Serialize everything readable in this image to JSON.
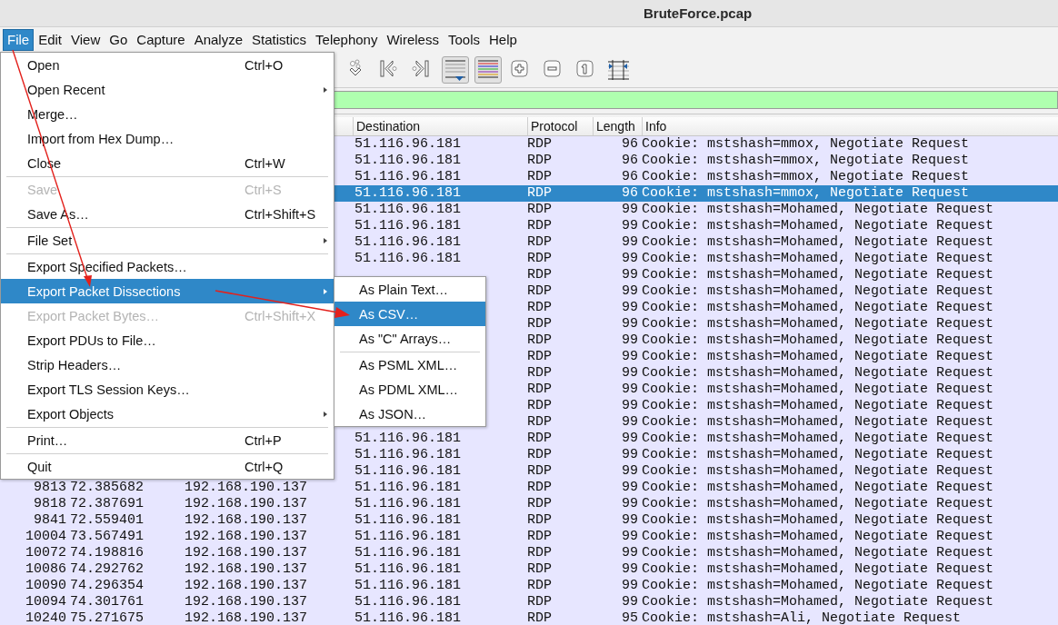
{
  "window": {
    "title": "BruteForce.pcap"
  },
  "menubar": [
    {
      "label": "File",
      "selected": true
    },
    {
      "label": "Edit",
      "selected": false
    },
    {
      "label": "View",
      "selected": false
    },
    {
      "label": "Go",
      "selected": false
    },
    {
      "label": "Capture",
      "selected": false
    },
    {
      "label": "Analyze",
      "selected": false
    },
    {
      "label": "Statistics",
      "selected": false
    },
    {
      "label": "Telephony",
      "selected": false
    },
    {
      "label": "Wireless",
      "selected": false
    },
    {
      "label": "Tools",
      "selected": false
    },
    {
      "label": "Help",
      "selected": false
    }
  ],
  "toolbar": [
    {
      "kind": "next-packet",
      "on": false
    },
    {
      "kind": "first-packet",
      "on": false
    },
    {
      "kind": "last-packet",
      "on": false
    },
    {
      "kind": "autoscroll",
      "on": true
    },
    {
      "kind": "colorize",
      "on": true
    },
    {
      "kind": "zoom-in",
      "on": false
    },
    {
      "kind": "zoom-out",
      "on": false
    },
    {
      "kind": "normal-size",
      "on": false
    },
    {
      "kind": "resize-columns",
      "on": false
    }
  ],
  "filter_bar": {
    "valid": true
  },
  "table": {
    "columns": [
      "Destination",
      "Protocol",
      "Length",
      "Info"
    ],
    "rows": [
      {
        "destination": "51.116.96.181",
        "protocol": "RDP",
        "length": "96",
        "info": "Cookie: mstshash=mmox, Negotiate Request",
        "selected": false
      },
      {
        "destination": "51.116.96.181",
        "protocol": "RDP",
        "length": "96",
        "info": "Cookie: mstshash=mmox, Negotiate Request",
        "selected": false
      },
      {
        "destination": "51.116.96.181",
        "protocol": "RDP",
        "length": "96",
        "info": "Cookie: mstshash=mmox, Negotiate Request",
        "selected": false
      },
      {
        "destination": "51.116.96.181",
        "protocol": "RDP",
        "length": "96",
        "info": "Cookie: mstshash=mmox, Negotiate Request",
        "selected": true
      },
      {
        "destination": "51.116.96.181",
        "protocol": "RDP",
        "length": "99",
        "info": "Cookie: mstshash=Mohamed, Negotiate Request",
        "selected": false
      },
      {
        "destination": "51.116.96.181",
        "protocol": "RDP",
        "length": "99",
        "info": "Cookie: mstshash=Mohamed, Negotiate Request",
        "selected": false
      },
      {
        "destination": "51.116.96.181",
        "protocol": "RDP",
        "length": "99",
        "info": "Cookie: mstshash=Mohamed, Negotiate Request",
        "selected": false
      },
      {
        "destination": "51.116.96.181",
        "protocol": "RDP",
        "length": "99",
        "info": "Cookie: mstshash=Mohamed, Negotiate Request",
        "selected": false
      },
      {
        "protocol": "RDP",
        "length": "99",
        "info": "Cookie: mstshash=Mohamed, Negotiate Request",
        "selected": false
      },
      {
        "protocol": "RDP",
        "length": "99",
        "info": "Cookie: mstshash=Mohamed, Negotiate Request",
        "selected": false
      },
      {
        "protocol": "RDP",
        "length": "99",
        "info": "Cookie: mstshash=Mohamed, Negotiate Request",
        "selected": false
      },
      {
        "protocol": "RDP",
        "length": "99",
        "info": "Cookie: mstshash=Mohamed, Negotiate Request",
        "selected": false
      },
      {
        "protocol": "RDP",
        "length": "99",
        "info": "Cookie: mstshash=Mohamed, Negotiate Request",
        "selected": false
      },
      {
        "protocol": "RDP",
        "length": "99",
        "info": "Cookie: mstshash=Mohamed, Negotiate Request",
        "selected": false
      },
      {
        "protocol": "RDP",
        "length": "99",
        "info": "Cookie: mstshash=Mohamed, Negotiate Request",
        "selected": false
      },
      {
        "protocol": "RDP",
        "length": "99",
        "info": "Cookie: mstshash=Mohamed, Negotiate Request",
        "selected": false
      },
      {
        "protocol": "RDP",
        "length": "99",
        "info": "Cookie: mstshash=Mohamed, Negotiate Request",
        "selected": false
      },
      {
        "protocol": "RDP",
        "length": "99",
        "info": "Cookie: mstshash=Mohamed, Negotiate Request",
        "selected": false
      },
      {
        "destination": "51.116.96.181",
        "protocol": "RDP",
        "length": "99",
        "info": "Cookie: mstshash=Mohamed, Negotiate Request",
        "selected": false
      },
      {
        "destination": "51.116.96.181",
        "protocol": "RDP",
        "length": "99",
        "info": "Cookie: mstshash=Mohamed, Negotiate Request",
        "selected": false
      },
      {
        "destination": "51.116.96.181",
        "protocol": "RDP",
        "length": "99",
        "info": "Cookie: mstshash=Mohamed, Negotiate Request",
        "selected": false
      },
      {
        "no": "9813",
        "time": "72.385682",
        "source": "192.168.190.137",
        "destination": "51.116.96.181",
        "protocol": "RDP",
        "length": "99",
        "info": "Cookie: mstshash=Mohamed, Negotiate Request",
        "selected": false
      },
      {
        "no": "9818",
        "time": "72.387691",
        "source": "192.168.190.137",
        "destination": "51.116.96.181",
        "protocol": "RDP",
        "length": "99",
        "info": "Cookie: mstshash=Mohamed, Negotiate Request",
        "selected": false
      },
      {
        "no": "9841",
        "time": "72.559401",
        "source": "192.168.190.137",
        "destination": "51.116.96.181",
        "protocol": "RDP",
        "length": "99",
        "info": "Cookie: mstshash=Mohamed, Negotiate Request",
        "selected": false
      },
      {
        "no": "10004",
        "time": "73.567491",
        "source": "192.168.190.137",
        "destination": "51.116.96.181",
        "protocol": "RDP",
        "length": "99",
        "info": "Cookie: mstshash=Mohamed, Negotiate Request",
        "selected": false
      },
      {
        "no": "10072",
        "time": "74.198816",
        "source": "192.168.190.137",
        "destination": "51.116.96.181",
        "protocol": "RDP",
        "length": "99",
        "info": "Cookie: mstshash=Mohamed, Negotiate Request",
        "selected": false
      },
      {
        "no": "10086",
        "time": "74.292762",
        "source": "192.168.190.137",
        "destination": "51.116.96.181",
        "protocol": "RDP",
        "length": "99",
        "info": "Cookie: mstshash=Mohamed, Negotiate Request",
        "selected": false
      },
      {
        "no": "10090",
        "time": "74.296354",
        "source": "192.168.190.137",
        "destination": "51.116.96.181",
        "protocol": "RDP",
        "length": "99",
        "info": "Cookie: mstshash=Mohamed, Negotiate Request",
        "selected": false
      },
      {
        "no": "10094",
        "time": "74.301761",
        "source": "192.168.190.137",
        "destination": "51.116.96.181",
        "protocol": "RDP",
        "length": "99",
        "info": "Cookie: mstshash=Mohamed, Negotiate Request",
        "selected": false
      },
      {
        "no": "10240",
        "time": "75.271675",
        "source": "192.168.190.137",
        "destination": "51.116.96.181",
        "protocol": "RDP",
        "length": "95",
        "info": "Cookie: mstshash=Ali, Negotiate Request",
        "selected": false
      }
    ]
  },
  "file_menu": {
    "items": [
      {
        "kind": "item",
        "label": "Open",
        "shortcut": "Ctrl+O",
        "submenu": false,
        "disabled": false,
        "selected": false
      },
      {
        "kind": "item",
        "label": "Open Recent",
        "submenu": true,
        "disabled": false,
        "selected": false
      },
      {
        "kind": "item",
        "label": "Merge…",
        "submenu": false,
        "disabled": false,
        "selected": false
      },
      {
        "kind": "item",
        "label": "Import from Hex Dump…",
        "submenu": false,
        "disabled": false,
        "selected": false
      },
      {
        "kind": "item",
        "label": "Close",
        "shortcut": "Ctrl+W",
        "submenu": false,
        "disabled": false,
        "selected": false
      },
      {
        "kind": "separator"
      },
      {
        "kind": "item",
        "label": "Save",
        "shortcut": "Ctrl+S",
        "submenu": false,
        "disabled": true,
        "selected": false
      },
      {
        "kind": "item",
        "label": "Save As…",
        "shortcut": "Ctrl+Shift+S",
        "submenu": false,
        "disabled": false,
        "selected": false
      },
      {
        "kind": "separator"
      },
      {
        "kind": "item",
        "label": "File Set",
        "submenu": true,
        "disabled": false,
        "selected": false
      },
      {
        "kind": "separator"
      },
      {
        "kind": "item",
        "label": "Export Specified Packets…",
        "submenu": false,
        "disabled": false,
        "selected": false
      },
      {
        "kind": "item",
        "label": "Export Packet Dissections",
        "submenu": true,
        "disabled": false,
        "selected": true
      },
      {
        "kind": "item",
        "label": "Export Packet Bytes…",
        "shortcut": "Ctrl+Shift+X",
        "submenu": false,
        "disabled": true,
        "selected": false
      },
      {
        "kind": "item",
        "label": "Export PDUs to File…",
        "submenu": false,
        "disabled": false,
        "selected": false
      },
      {
        "kind": "item",
        "label": "Strip Headers…",
        "submenu": false,
        "disabled": false,
        "selected": false
      },
      {
        "kind": "item",
        "label": "Export TLS Session Keys…",
        "submenu": false,
        "disabled": false,
        "selected": false
      },
      {
        "kind": "item",
        "label": "Export Objects",
        "submenu": true,
        "disabled": false,
        "selected": false
      },
      {
        "kind": "separator"
      },
      {
        "kind": "item",
        "label": "Print…",
        "shortcut": "Ctrl+P",
        "submenu": false,
        "disabled": false,
        "selected": false
      },
      {
        "kind": "separator"
      },
      {
        "kind": "item",
        "label": "Quit",
        "shortcut": "Ctrl+Q",
        "submenu": false,
        "disabled": false,
        "selected": false
      }
    ]
  },
  "export_submenu": {
    "items": [
      {
        "kind": "item",
        "label": "As Plain Text…",
        "submenu": false,
        "disabled": false,
        "selected": false
      },
      {
        "kind": "item",
        "label": "As CSV…",
        "submenu": false,
        "disabled": false,
        "selected": true
      },
      {
        "kind": "item",
        "label": "As \"C\" Arrays…",
        "submenu": false,
        "disabled": false,
        "selected": false
      },
      {
        "kind": "separator"
      },
      {
        "kind": "item",
        "label": "As PSML XML…",
        "submenu": false,
        "disabled": false,
        "selected": false
      },
      {
        "kind": "item",
        "label": "As PDML XML…",
        "submenu": false,
        "disabled": false,
        "selected": false
      },
      {
        "kind": "item",
        "label": "As JSON…",
        "submenu": false,
        "disabled": false,
        "selected": false
      }
    ]
  }
}
